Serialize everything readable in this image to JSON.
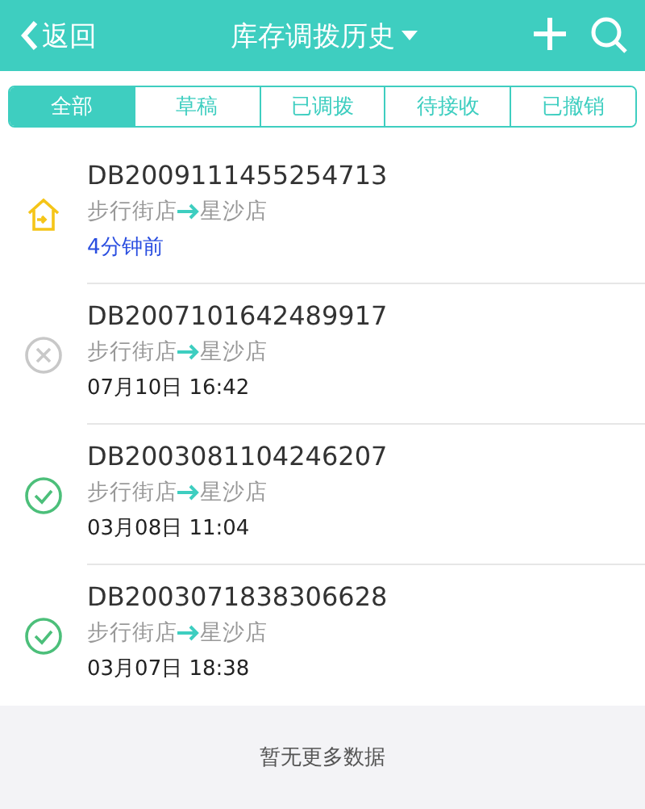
{
  "header": {
    "back": "返回",
    "title": "库存调拨历史"
  },
  "tabs": [
    {
      "label": "全部",
      "selected": true
    },
    {
      "label": "草稿",
      "selected": false
    },
    {
      "label": "已调拨",
      "selected": false
    },
    {
      "label": "待接收",
      "selected": false
    },
    {
      "label": "已撤销",
      "selected": false
    }
  ],
  "records": [
    {
      "kind": "pending",
      "number": "DB2009111455254713",
      "from": "步行街店",
      "to": "星沙店",
      "time": "4分钟前",
      "recent": true
    },
    {
      "kind": "cancelled",
      "number": "DB2007101642489917",
      "from": "步行街店",
      "to": "星沙店",
      "time": "07月10日 16:42",
      "recent": false
    },
    {
      "kind": "done",
      "number": "DB2003081104246207",
      "from": "步行街店",
      "to": "星沙店",
      "time": "03月08日 11:04",
      "recent": false
    },
    {
      "kind": "done",
      "number": "DB2003071838306628",
      "from": "步行街店",
      "to": "星沙店",
      "time": "03月07日 18:38",
      "recent": false
    }
  ],
  "footer": "暂无更多数据"
}
